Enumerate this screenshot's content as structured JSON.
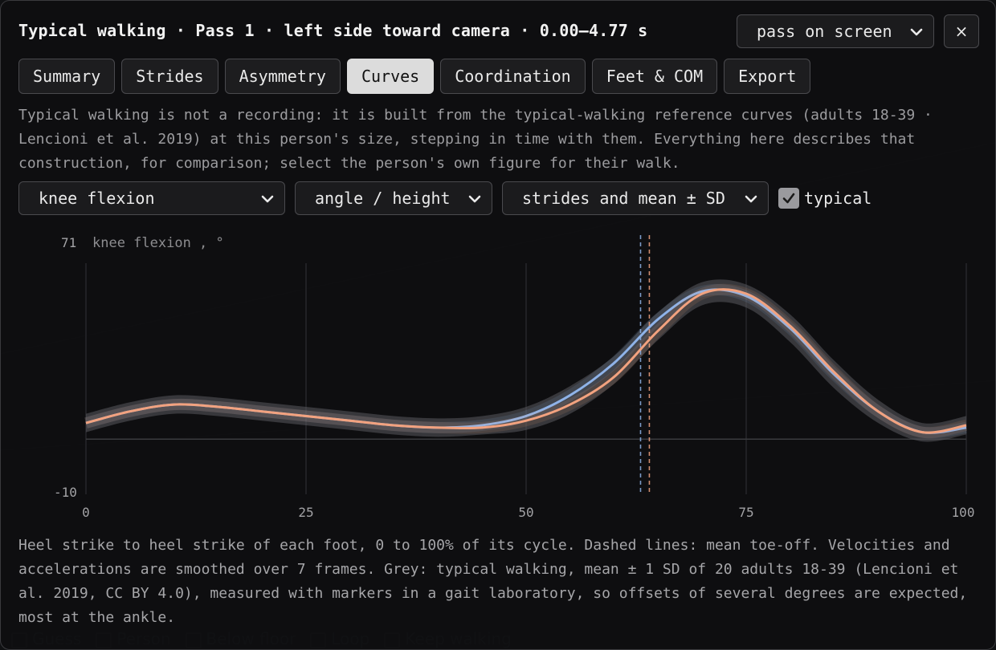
{
  "title": "Typical walking · Pass 1 · left side toward camera · 0.00–4.77 s",
  "view_select": {
    "value": "pass on screen"
  },
  "close_label": "×",
  "tabs": [
    {
      "label": "Summary"
    },
    {
      "label": "Strides"
    },
    {
      "label": "Asymmetry"
    },
    {
      "label": "Curves",
      "active": true
    },
    {
      "label": "Coordination"
    },
    {
      "label": "Feet & COM"
    },
    {
      "label": "Export"
    }
  ],
  "description": "Typical walking is not a recording: it is built from the typical-walking reference curves (adults 18-39 · Lencioni et al. 2019) at this person's size, stepping in time with them. Everything here describes that construction, for comparison; select the person's own figure for their walk.",
  "controls": {
    "variable": "knee flexion",
    "mode": "angle / height",
    "display": "strides and mean ± SD",
    "typical_label": "typical",
    "typical_checked": true
  },
  "colors": {
    "left_series": "#8fb3e8",
    "right_series": "#f2a27f",
    "typical_band": "#5a5a5e",
    "background": "#0e0e10"
  },
  "chart_data": {
    "type": "line",
    "ylabel": "knee flexion , °",
    "ylim": [
      -10,
      71
    ],
    "xlim": [
      0,
      100
    ],
    "x_ticks": [
      "0",
      "25",
      "50",
      "75",
      "100"
    ],
    "y_ticks": [
      "71",
      "-10"
    ],
    "x": [
      0,
      5,
      10,
      15,
      20,
      25,
      30,
      35,
      40,
      45,
      50,
      55,
      60,
      65,
      70,
      75,
      80,
      85,
      90,
      95,
      100
    ],
    "series": [
      {
        "values": [
          7,
          12,
          15,
          14,
          12,
          10,
          8,
          6,
          5,
          6,
          10,
          19,
          33,
          52,
          64,
          62,
          48,
          28,
          12,
          3,
          5
        ]
      },
      {
        "values": [
          7,
          12,
          15,
          14,
          12,
          10,
          8,
          6,
          5,
          5,
          8,
          15,
          27,
          47,
          63,
          63,
          49,
          29,
          12,
          3,
          6
        ]
      }
    ],
    "typical": {
      "mean": [
        7,
        12,
        15,
        14,
        12,
        10,
        8,
        6,
        5,
        6,
        9,
        17,
        30,
        49,
        63,
        62,
        48,
        28,
        12,
        3,
        6
      ],
      "sd": [
        4,
        4,
        4,
        4,
        4,
        4,
        4,
        4,
        4,
        4,
        5,
        6,
        6,
        6,
        5,
        5,
        6,
        6,
        5,
        4,
        4
      ]
    },
    "toe_off": [
      63,
      64
    ]
  },
  "caption": "Heel strike to heel strike of each foot, 0 to 100% of its cycle. Dashed lines: mean toe-off. Velocities and accelerations are smoothed over 7 frames. Grey: typical walking, mean ± 1 SD of 20 adults 18-39 (Lencioni et al. 2019, CC BY 4.0), measured with markers in a gait laboratory, so offsets of several degrees are expected, most at the ankle."
}
